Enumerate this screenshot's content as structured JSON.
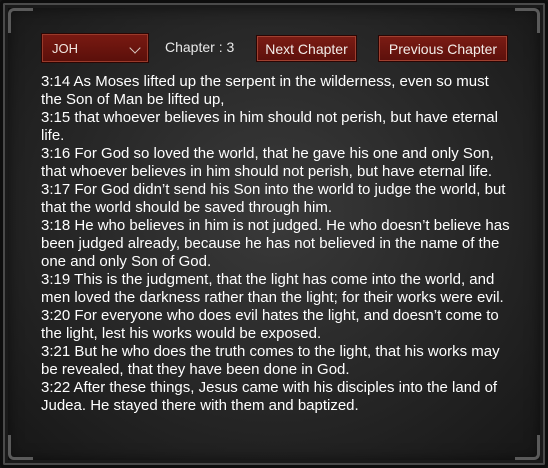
{
  "toolbar": {
    "book_value": "JOH",
    "chapter_label": "Chapter : 3",
    "next_label": "Next Chapter",
    "prev_label": "Previous Chapter"
  },
  "verses": [
    "3:14 As Moses lifted up the serpent in the wilderness, even so must the Son of Man be lifted up,",
    "3:15 that whoever believes in him should not perish, but have eternal life.",
    "3:16 For God so loved the world, that he gave his one and only Son, that whoever believes in him should not perish, but have eternal life.",
    "3:17 For God didn’t send his Son into the world to judge the world, but that the world should be saved through him.",
    "3:18 He who believes in him is not judged. He who doesn’t believe has been judged already, because he has not believed in the name of the one and only Son of God.",
    "3:19 This is the judgment, that the light has come into the world, and men loved the darkness rather than the light; for their works were evil.",
    "3:20 For everyone who does evil hates the light, and doesn’t come to the light, lest his works would be exposed.",
    "3:21 But he who does the truth comes to the light, that his works may be revealed, that they have been done in God.",
    "3:22 After these things, Jesus came with his disciples into the land of Judea. He stayed there with them and baptized."
  ]
}
